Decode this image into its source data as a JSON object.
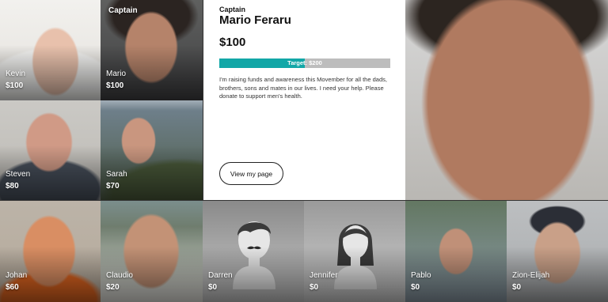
{
  "team": [
    {
      "name": "Kevin",
      "amount": "$100",
      "role": ""
    },
    {
      "name": "Mario",
      "amount": "$100",
      "role": "Captain"
    },
    {
      "name": "Steven",
      "amount": "$80",
      "role": ""
    },
    {
      "name": "Sarah",
      "amount": "$70",
      "role": ""
    },
    {
      "name": "Johan",
      "amount": "$60",
      "role": ""
    },
    {
      "name": "Claudio",
      "amount": "$20",
      "role": ""
    },
    {
      "name": "Darren",
      "amount": "$0",
      "role": ""
    },
    {
      "name": "Jennifer",
      "amount": "$0",
      "role": ""
    },
    {
      "name": "Pablo",
      "amount": "$0",
      "role": ""
    },
    {
      "name": "Zion-Elijah",
      "amount": "$0",
      "role": ""
    }
  ],
  "selected": {
    "role": "Captain",
    "name": "Mario Feraru",
    "raised": "$100",
    "target_label": "Target: $200",
    "progress_fraction": 0.5,
    "message": "I'm raising funds and awareness this Movember for all the dads, brothers, sons and mates in our lives. I need your help. Please donate to support men's health.",
    "button_label": "View my page"
  },
  "colors": {
    "accent": "#12a7a7",
    "bar_track": "#bdbdbd"
  },
  "icons": {
    "male_placeholder": "male-silhouette-icon",
    "female_placeholder": "female-silhouette-icon"
  }
}
